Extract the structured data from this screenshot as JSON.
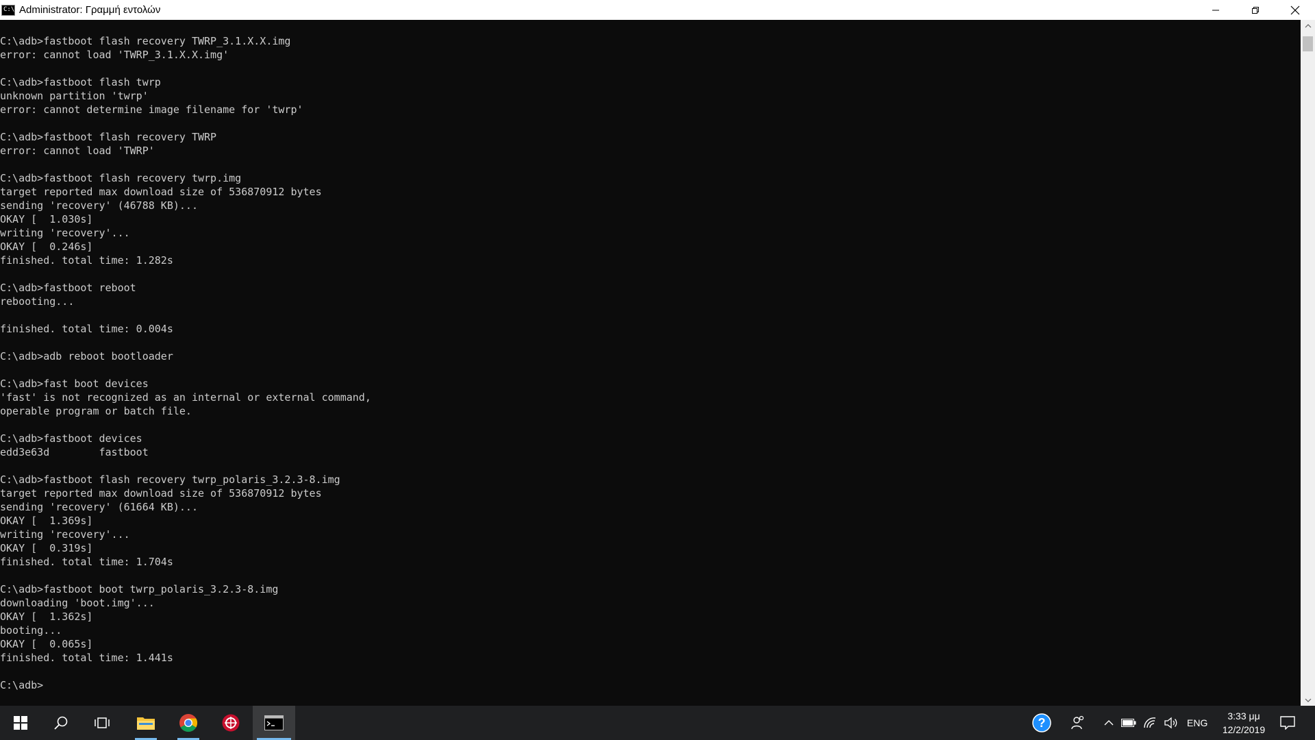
{
  "window": {
    "title": "Administrator: Γραμμή εντολών",
    "icon_text": "C:\\"
  },
  "console": {
    "lines": [
      "C:\\adb>fastboot flash recovery TWRP_3.1.X.X.img",
      "error: cannot load 'TWRP_3.1.X.X.img'",
      "",
      "C:\\adb>fastboot flash twrp",
      "unknown partition 'twrp'",
      "error: cannot determine image filename for 'twrp'",
      "",
      "C:\\adb>fastboot flash recovery TWRP",
      "error: cannot load 'TWRP'",
      "",
      "C:\\adb>fastboot flash recovery twrp.img",
      "target reported max download size of 536870912 bytes",
      "sending 'recovery' (46788 KB)...",
      "OKAY [  1.030s]",
      "writing 'recovery'...",
      "OKAY [  0.246s]",
      "finished. total time: 1.282s",
      "",
      "C:\\adb>fastboot reboot",
      "rebooting...",
      "",
      "finished. total time: 0.004s",
      "",
      "C:\\adb>adb reboot bootloader",
      "",
      "C:\\adb>fast boot devices",
      "'fast' is not recognized as an internal or external command,",
      "operable program or batch file.",
      "",
      "C:\\adb>fastboot devices",
      "edd3e63d        fastboot",
      "",
      "C:\\adb>fastboot flash recovery twrp_polaris_3.2.3-8.img",
      "target reported max download size of 536870912 bytes",
      "sending 'recovery' (61664 KB)...",
      "OKAY [  1.369s]",
      "writing 'recovery'...",
      "OKAY [  0.319s]",
      "finished. total time: 1.704s",
      "",
      "C:\\adb>fastboot boot twrp_polaris_3.2.3-8.img",
      "downloading 'boot.img'...",
      "OKAY [  1.362s]",
      "booting...",
      "OKAY [  0.065s]",
      "finished. total time: 1.441s",
      "",
      "C:\\adb>"
    ]
  },
  "taskbar": {
    "language": "ENG",
    "time": "3:33 μμ",
    "date": "12/2/2019",
    "help_glyph": "?"
  },
  "colors": {
    "console_bg": "#0c0c0c",
    "console_text": "#cccccc",
    "taskbar_bg": "#1f2022",
    "accent": "#76b9ed"
  }
}
